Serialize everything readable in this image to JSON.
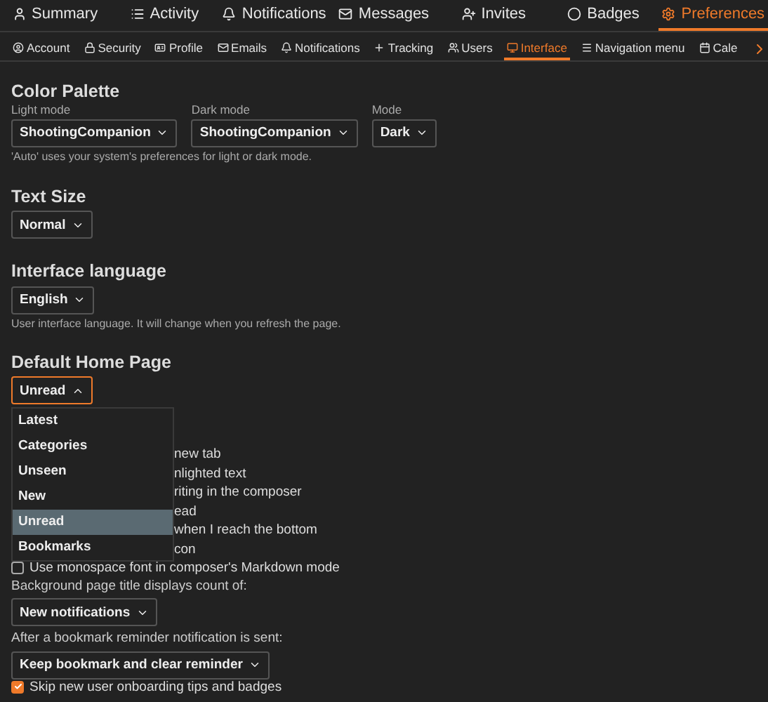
{
  "main_tabs": [
    {
      "label": "Summary",
      "selected": false
    },
    {
      "label": "Activity",
      "selected": false
    },
    {
      "label": "Notifications",
      "selected": false
    },
    {
      "label": "Messages",
      "selected": false
    },
    {
      "label": "Invites",
      "selected": false
    },
    {
      "label": "Badges",
      "selected": false
    },
    {
      "label": "Preferences",
      "selected": true
    }
  ],
  "sub_tabs": [
    {
      "label": "Account",
      "selected": false
    },
    {
      "label": "Security",
      "selected": false
    },
    {
      "label": "Profile",
      "selected": false
    },
    {
      "label": "Emails",
      "selected": false
    },
    {
      "label": "Notifications",
      "selected": false
    },
    {
      "label": "Tracking",
      "selected": false
    },
    {
      "label": "Users",
      "selected": false
    },
    {
      "label": "Interface",
      "selected": true
    },
    {
      "label": "Navigation menu",
      "selected": false
    },
    {
      "label": "Cale",
      "selected": false
    }
  ],
  "color_palette": {
    "title": "Color Palette",
    "fields": [
      {
        "label": "Light mode",
        "value": "ShootingCompanion"
      },
      {
        "label": "Dark mode",
        "value": "ShootingCompanion"
      },
      {
        "label": "Mode",
        "value": "Dark"
      }
    ],
    "help": "'Auto' uses your system's preferences for light or dark mode."
  },
  "text_size": {
    "title": "Text Size",
    "value": "Normal"
  },
  "interface_language": {
    "title": "Interface language",
    "value": "English",
    "help": "User interface language. It will change when you refresh the page."
  },
  "default_home_page": {
    "title": "Default Home Page",
    "value": "Unread",
    "expanded": true,
    "options": [
      {
        "label": "Latest",
        "selected": false
      },
      {
        "label": "Categories",
        "selected": false
      },
      {
        "label": "Unseen",
        "selected": false
      },
      {
        "label": "New",
        "selected": false
      },
      {
        "label": "Unread",
        "selected": true
      },
      {
        "label": "Bookmarks",
        "selected": false
      }
    ]
  },
  "options": [
    {
      "kind": "covered",
      "label": "new tab"
    },
    {
      "kind": "covered",
      "label": "nlighted text"
    },
    {
      "kind": "covered",
      "label": "riting in the composer"
    },
    {
      "kind": "covered",
      "label": "ead"
    },
    {
      "kind": "covered",
      "label": "when I reach the bottom"
    },
    {
      "kind": "covered",
      "label": "con"
    },
    {
      "kind": "checkbox",
      "label": "Use monospace font in composer's Markdown mode",
      "checked": false
    }
  ],
  "title_count": {
    "label": "Background page title displays count of:",
    "value": "New notifications"
  },
  "bookmark_reminder": {
    "label": "After a bookmark reminder notification is sent:",
    "value": "Keep bookmark and clear reminder"
  },
  "onboarding": {
    "label": "Skip new user onboarding tips and badges",
    "checked": true
  }
}
